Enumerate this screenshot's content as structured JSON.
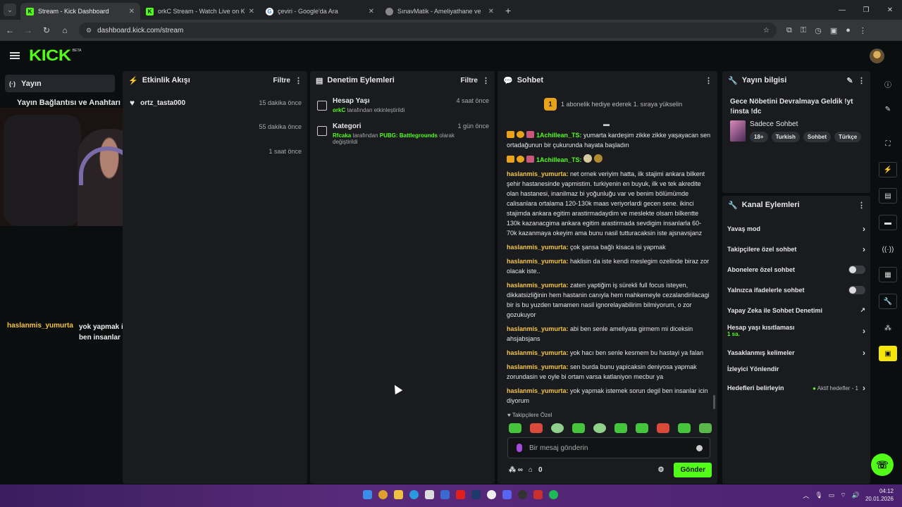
{
  "browser": {
    "tabs": [
      {
        "title": "Stream - Kick Dashboard",
        "icon": "kick-icon",
        "active": true
      },
      {
        "title": "orkC Stream - Watch Live on Ki",
        "icon": "kick-icon",
        "active": false
      },
      {
        "title": "çeviri - Google'da Ara",
        "icon": "google-icon",
        "active": false
      },
      {
        "title": "SınavMatik - Ameliyathane ve",
        "icon": "page-icon",
        "active": false
      }
    ],
    "url": "dashboard.kick.com/stream"
  },
  "header": {
    "logo": "KICK",
    "beta": "BETA"
  },
  "nav": {
    "live_label": "Yayın",
    "stream_keys_label": "Yayın Bağlantısı ve Anahtarı"
  },
  "overlay_chat": {
    "user": "haslanmis_yumurta",
    "message": "yok yapmak istemek sorun degil ben insanlar icin diyorum"
  },
  "activity": {
    "title": "Etkinlik Akışı",
    "filter": "Filtre",
    "items": [
      {
        "name": "ortz_tasta000",
        "time": "15 dakika önce"
      },
      {
        "name": "",
        "time": "55 dakika önce"
      },
      {
        "name": "",
        "time": "1 saat önce"
      }
    ]
  },
  "audit": {
    "title": "Denetim Eylemleri",
    "filter": "Filtre",
    "items": [
      {
        "heading": "Hesap Yaşı",
        "actor": "orkC",
        "desc": "tarafından etkinleştirildi",
        "time": "4 saat önce"
      },
      {
        "heading": "Kategori",
        "actor": "Rfcaka",
        "desc_pre": "tarafından",
        "target": "PUBG: Battlegrounds",
        "desc_post": "olarak değiştirildi",
        "time": "1 gün önce"
      }
    ]
  },
  "chat": {
    "title": "Sohbet",
    "sub_goal_badge": "1",
    "sub_goal": "1 abonelik hediye ederek 1. sıraya yükselin",
    "messages": [
      {
        "user": "1Achillean_TS:",
        "text": "yumarta kardeşim zikke zikke yaşayacan sen ortadağunun bir çukurunda hayata başladın",
        "green": true
      },
      {
        "user": "1Achillean_TS:",
        "text": "",
        "green": true
      },
      {
        "user": "haslanmis_yumurta:",
        "text": "net ornek veriyim hatta, ilk stajimi ankara bilkent şehir hastanesinde yapmistim. turkiyenin en buyuk, ilk ve tek akredite olan hastanesi, inanilmaz bi yoğunluğu var ve benim bölümümde calisanlara ortalama 120-130k maas veriyorlardi gecen sene. ikinci stajimda ankara egitim arastirmadaydim ve meslekte olsam bilkentte 130k kazanacgima ankara egitim arastirmada sevdigim insanlarla 60-70k kazanmaya okeyim ama bunu nasil tutturacaksin iste ajsnavsjanz"
      },
      {
        "user": "haslanmis_yumurta:",
        "text": "çok şansa bağlı kisaca isi yapmak"
      },
      {
        "user": "haslanmis_yumurta:",
        "text": "haklisin da iste kendi meslegim ozelinde biraz zor olacak iste.."
      },
      {
        "user": "haslanmis_yumurta:",
        "text": "zaten yaptiğim iş sürekli full focus isteyen, dikkatsizliğinin hem hastanin canıyla hem mahkemeyle cezalandirilacagi bir is bu yuzden tamamen nasil ignorelayabilirim bilmiyorum, o zor gozukuyor"
      },
      {
        "user": "haslanmis_yumurta:",
        "text": "abi ben senle ameliyata girmem mi diceksin ahsjabsjans"
      },
      {
        "user": "haslanmis_yumurta:",
        "text": "yok hacı ben senle kesmem bu hastayi ya falan"
      },
      {
        "user": "haslanmis_yumurta:",
        "text": "sen burda bunu yapicaksin deniyosa yapmak zorundasin ve oyle bi ortam varsa katlaniyon mecbur ya"
      },
      {
        "user": "haslanmis_yumurta:",
        "text": "yok yapmak istemek sorun degil ben insanlar icin diyorum"
      }
    ],
    "followers_only": "Takipçilere Özel",
    "placeholder": "Bir mesaj gönderin",
    "count": "0",
    "send": "Gönder"
  },
  "info": {
    "title": "Yayın bilgisi",
    "stream_title": "Gece Nöbetini Devralmaya Geldik !yt !insta !dc",
    "category": "Sadece Sohbet",
    "tags": [
      "18+",
      "Turkish",
      "Sohbet",
      "Türkçe"
    ]
  },
  "channel": {
    "title": "Kanal Eylemleri",
    "items": [
      {
        "label": "Yavaş mod",
        "kind": "chevron"
      },
      {
        "label": "Takipçilere özel sohbet",
        "kind": "chevron"
      },
      {
        "label": "Abonelere özel sohbet",
        "kind": "toggle"
      },
      {
        "label": "Yalnızca ifadelerle sohbet",
        "kind": "toggle"
      },
      {
        "label": "Yapay Zeka ile Sohbet Denetimi",
        "kind": "external"
      },
      {
        "label": "Hesap yaşı kısıtlaması",
        "kind": "chevron",
        "sub": "1 sa."
      },
      {
        "label": "Yasaklanmış kelimeler",
        "kind": "chevron"
      },
      {
        "label": "İzleyici Yönlendir",
        "kind": "none"
      },
      {
        "label": "Hedefleri belirleyin",
        "kind": "chevron",
        "aside": "Aktif hedefler - 1"
      }
    ]
  },
  "taskbar": {
    "time": "04:12",
    "date": "20.01.2026"
  },
  "colors": {
    "accent": "#53fc18",
    "username": "#f5c542",
    "panel": "#191b1f",
    "taskbar": "#4a2270"
  }
}
